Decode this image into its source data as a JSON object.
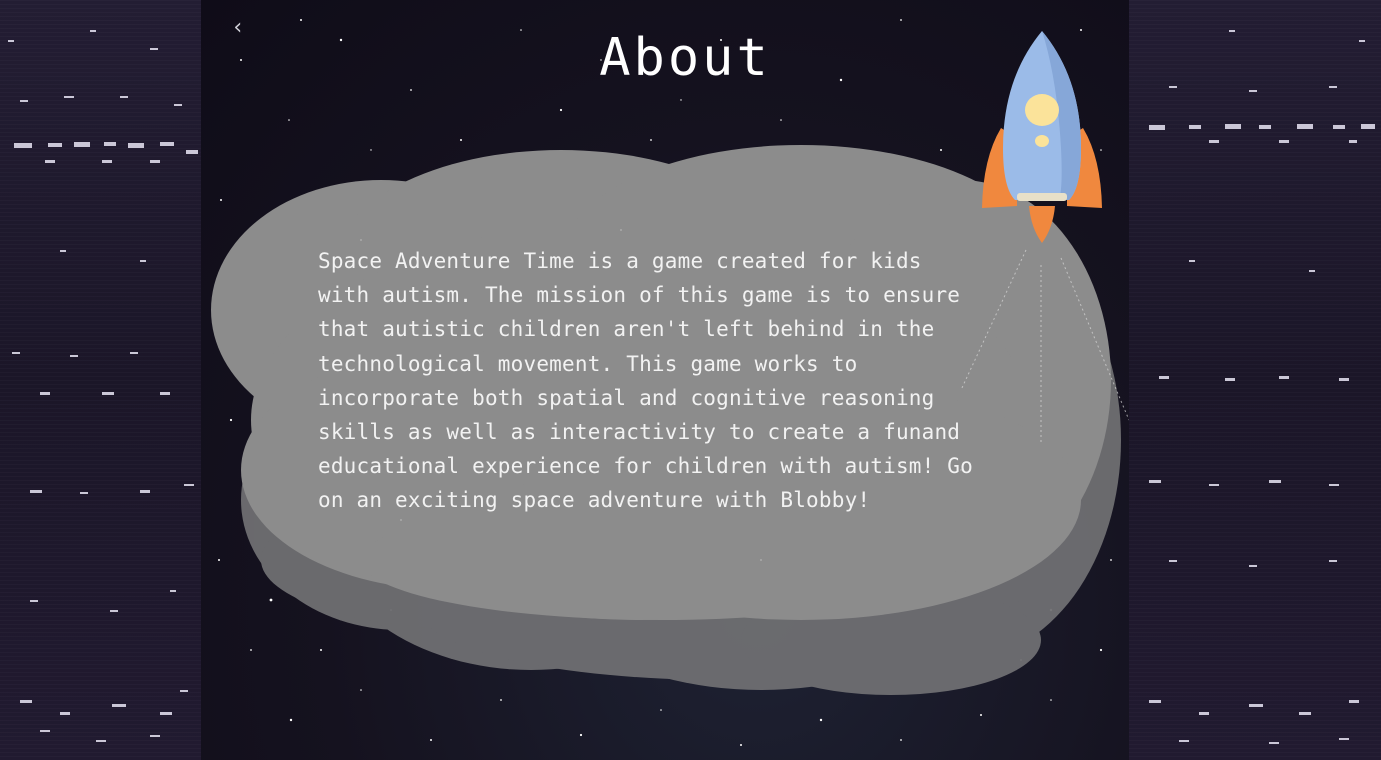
{
  "header": {
    "back_glyph": "‹",
    "title": "About"
  },
  "about": {
    "body": "Space Adventure Time is a game created for kids\nwith autism. The mission of this game is to ensure\nthat autistic children aren't left behind in the\ntechnological movement. This game works to\nincorporate both spatial and cognitive reasoning\nskills as well as interactivity to create a funand\neducational experience for children with autism! Go\non an exciting space adventure with Blobby!"
  },
  "theme": {
    "cloud_color": "#8c8c8c",
    "cloud_shadow": "#6f6f72",
    "rocket_body": "#9bbbe8",
    "rocket_fins": "#f0883e",
    "rocket_window": "#fbe39a",
    "text_color": "#f2f2f2"
  },
  "icons": {
    "back": "chevron-left-icon",
    "rocket": "rocket-icon"
  }
}
